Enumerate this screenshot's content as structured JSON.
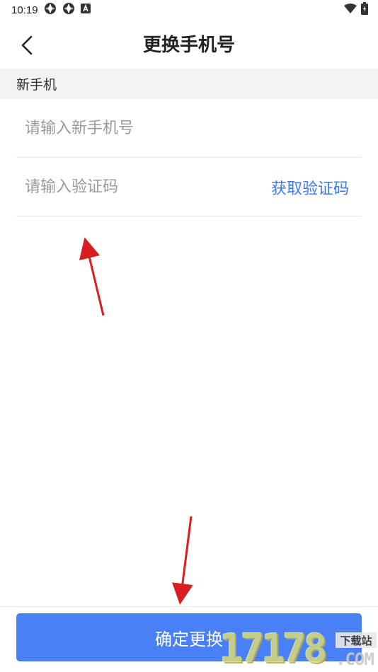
{
  "status_bar": {
    "time": "10:19",
    "left_icons": [
      "app-icon",
      "app-icon",
      "a-icon"
    ],
    "right_icons": [
      "wifi-icon",
      "battery-icon"
    ]
  },
  "nav": {
    "back_icon": "chevron-left-icon",
    "title": "更换手机号"
  },
  "section": {
    "header": "新手机"
  },
  "form": {
    "phone_placeholder": "请输入新手机号",
    "phone_value": "",
    "code_placeholder": "请输入验证码",
    "code_value": "",
    "get_code_label": "获取验证码"
  },
  "actions": {
    "confirm_label": "确定更换"
  },
  "watermark": {
    "digits": "17178",
    "domain": ".COM",
    "tag": "下载站"
  },
  "colors": {
    "accent": "#4a80f5",
    "link": "#3a7bf0",
    "section_bg": "#f3f3f3",
    "annotation_arrow": "#d81e1e"
  }
}
